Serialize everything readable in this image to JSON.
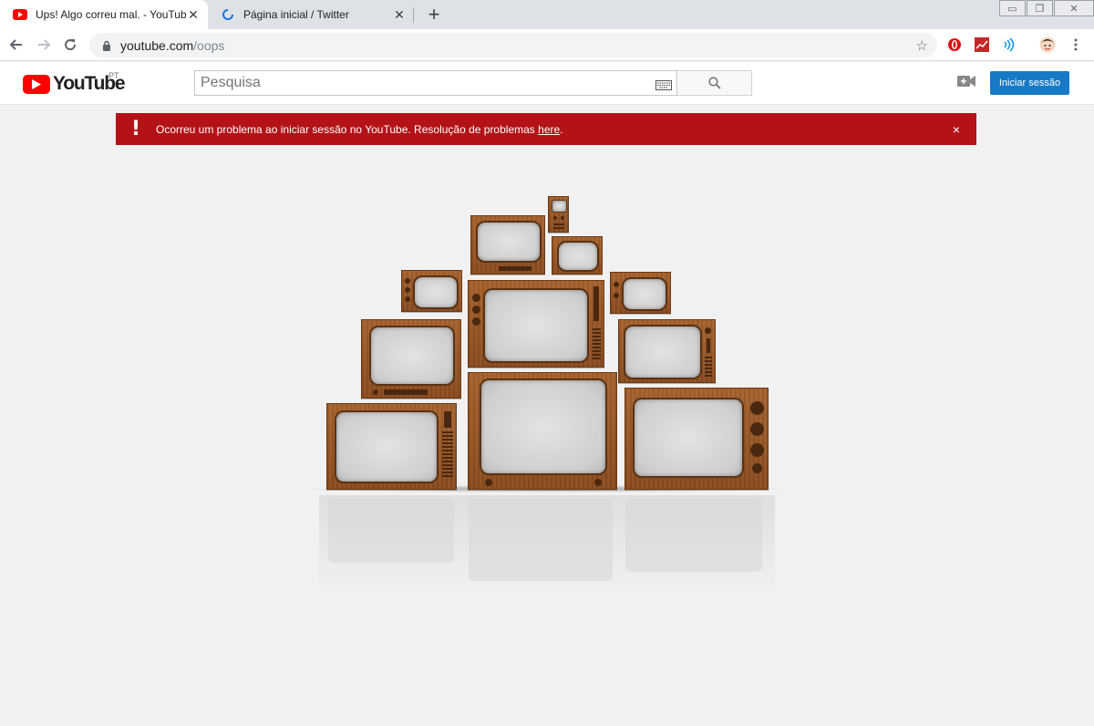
{
  "browser": {
    "tabs": [
      {
        "title": "Ups! Algo correu mal. - YouTube",
        "active": true,
        "icon": "youtube-favicon"
      },
      {
        "title": "Página inicial / Twitter",
        "active": false,
        "icon": "loading-spinner-icon"
      }
    ],
    "new_tab_label": "+",
    "address": {
      "host": "youtube.com",
      "path": "/oops"
    }
  },
  "masthead": {
    "logo_text": "YouTube",
    "country_code": "PT",
    "search_placeholder": "Pesquisa",
    "signin_label": "Iniciar sessão"
  },
  "alert": {
    "message": "Ocorreu um problema ao iniciar sessão no YouTube. Resolução de problemas ",
    "link_text": "here",
    "suffix": ".",
    "close_label": "×",
    "icon": "!"
  },
  "colors": {
    "alert_bg": "#b31217",
    "signin_bg": "#167ac6",
    "youtube_red": "#ff0000",
    "page_bg": "#f1f1f1"
  }
}
